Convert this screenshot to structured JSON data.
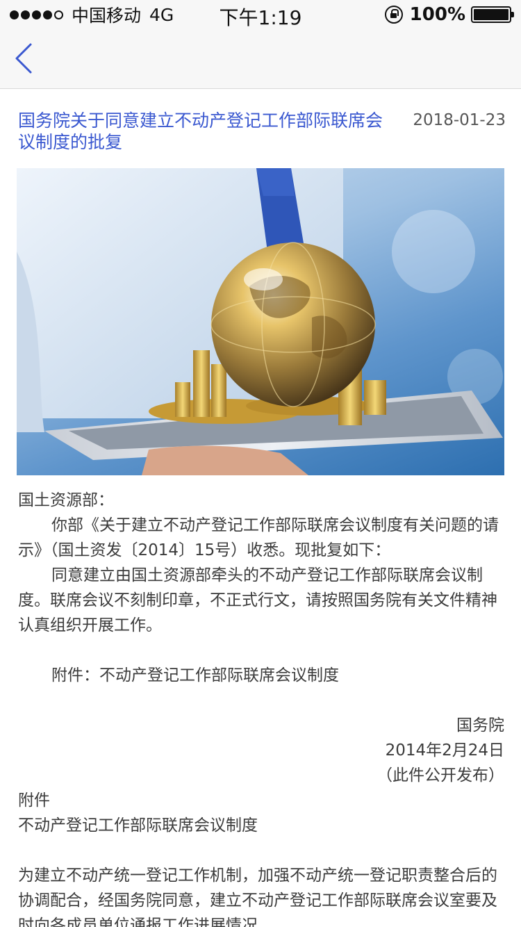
{
  "status_bar": {
    "carrier": "中国移动",
    "network": "4G",
    "time": "下午1:19",
    "battery": "100%",
    "signal_bars": 4
  },
  "nav": {
    "back_icon": "chevron-left-icon",
    "accent": "#3a58d0"
  },
  "article": {
    "title": "国务院关于同意建立不动产登记工作部际联席会议制度的批复",
    "date": "2018-01-23",
    "hero_image": "man holding tablet with golden globe and gold coins",
    "body": {
      "salutation": "国土资源部：",
      "para1": "你部《关于建立不动产登记工作部际联席会议制度有关问题的请示》（国土资发〔2014〕15号）收悉。现批复如下：",
      "para2": "同意建立由国土资源部牵头的不动产登记工作部际联席会议制度。联席会议不刻制印章，不正式行文，请按照国务院有关文件精神认真组织开展工作。",
      "attachment_line": "附件：不动产登记工作部际联席会议制度",
      "issuer": "国务院",
      "issue_date": "2014年2月24日",
      "publish_note": "（此件公开发布）",
      "attachment_heading": "附件",
      "attachment_title": "不动产登记工作部际联席会议制度",
      "para3": "为建立不动产统一登记工作机制，加强不动产统一登记职责整合后的协调配合，经国务院同意，建立不动产登记工作部际联席会议室要及时向各成员单位通报工作进展情况"
    }
  }
}
